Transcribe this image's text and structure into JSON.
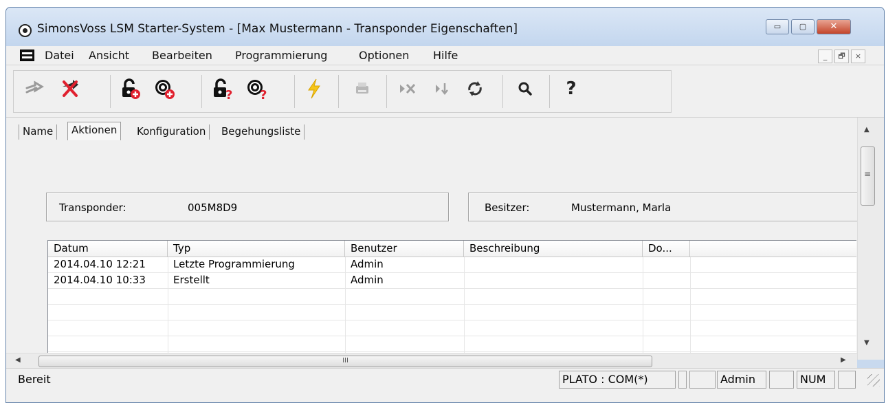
{
  "window": {
    "title": "SimonsVoss LSM Starter-System - [Max Mustermann - Transponder Eigenschaften]",
    "controls": {
      "minimize": "▭",
      "maximize": "▢",
      "close": "✕"
    }
  },
  "menu": {
    "items": [
      "Datei",
      "Ansicht",
      "Bearbeiten",
      "Programmierung",
      "Optionen",
      "Hilfe"
    ],
    "mdi_controls": {
      "minimize": "_",
      "restore": "🗗",
      "close": "×"
    }
  },
  "toolbar": {
    "buttons": [
      {
        "icon": "transfer-arrow-icon"
      },
      {
        "icon": "delete-cross-icon"
      },
      {
        "icon": "lock-add-icon"
      },
      {
        "icon": "transponder-add-icon"
      },
      {
        "icon": "lock-query-icon"
      },
      {
        "icon": "transponder-query-icon"
      },
      {
        "icon": "program-lightning-icon"
      },
      {
        "icon": "print-icon"
      },
      {
        "icon": "skip-cross-icon"
      },
      {
        "icon": "step-down-icon"
      },
      {
        "icon": "refresh-icon"
      },
      {
        "icon": "search-icon"
      },
      {
        "icon": "help-icon"
      }
    ],
    "help_glyph": "?"
  },
  "tabs": [
    "Name",
    "Aktionen",
    "Konfiguration",
    "Begehungsliste"
  ],
  "active_tab": "Aktionen",
  "transponder": {
    "label": "Transponder:",
    "value": "005M8D9"
  },
  "owner": {
    "label": "Besitzer:",
    "value": "Mustermann, Marla"
  },
  "table": {
    "columns": [
      "Datum",
      "Typ",
      "Benutzer",
      "Beschreibung",
      "Do..."
    ],
    "rows": [
      [
        "2014.04.10 12:21",
        "Letzte Programmierung",
        "Admin",
        "",
        ""
      ],
      [
        "2014.04.10 10:33",
        "Erstellt",
        "Admin",
        "",
        ""
      ]
    ]
  },
  "scrollbar": {
    "hthumb_grip": "III",
    "vthumb_grip": "≡"
  },
  "status": {
    "text": "Bereit",
    "plato": "PLATO : COM(*)",
    "user": "Admin",
    "num": "NUM"
  }
}
